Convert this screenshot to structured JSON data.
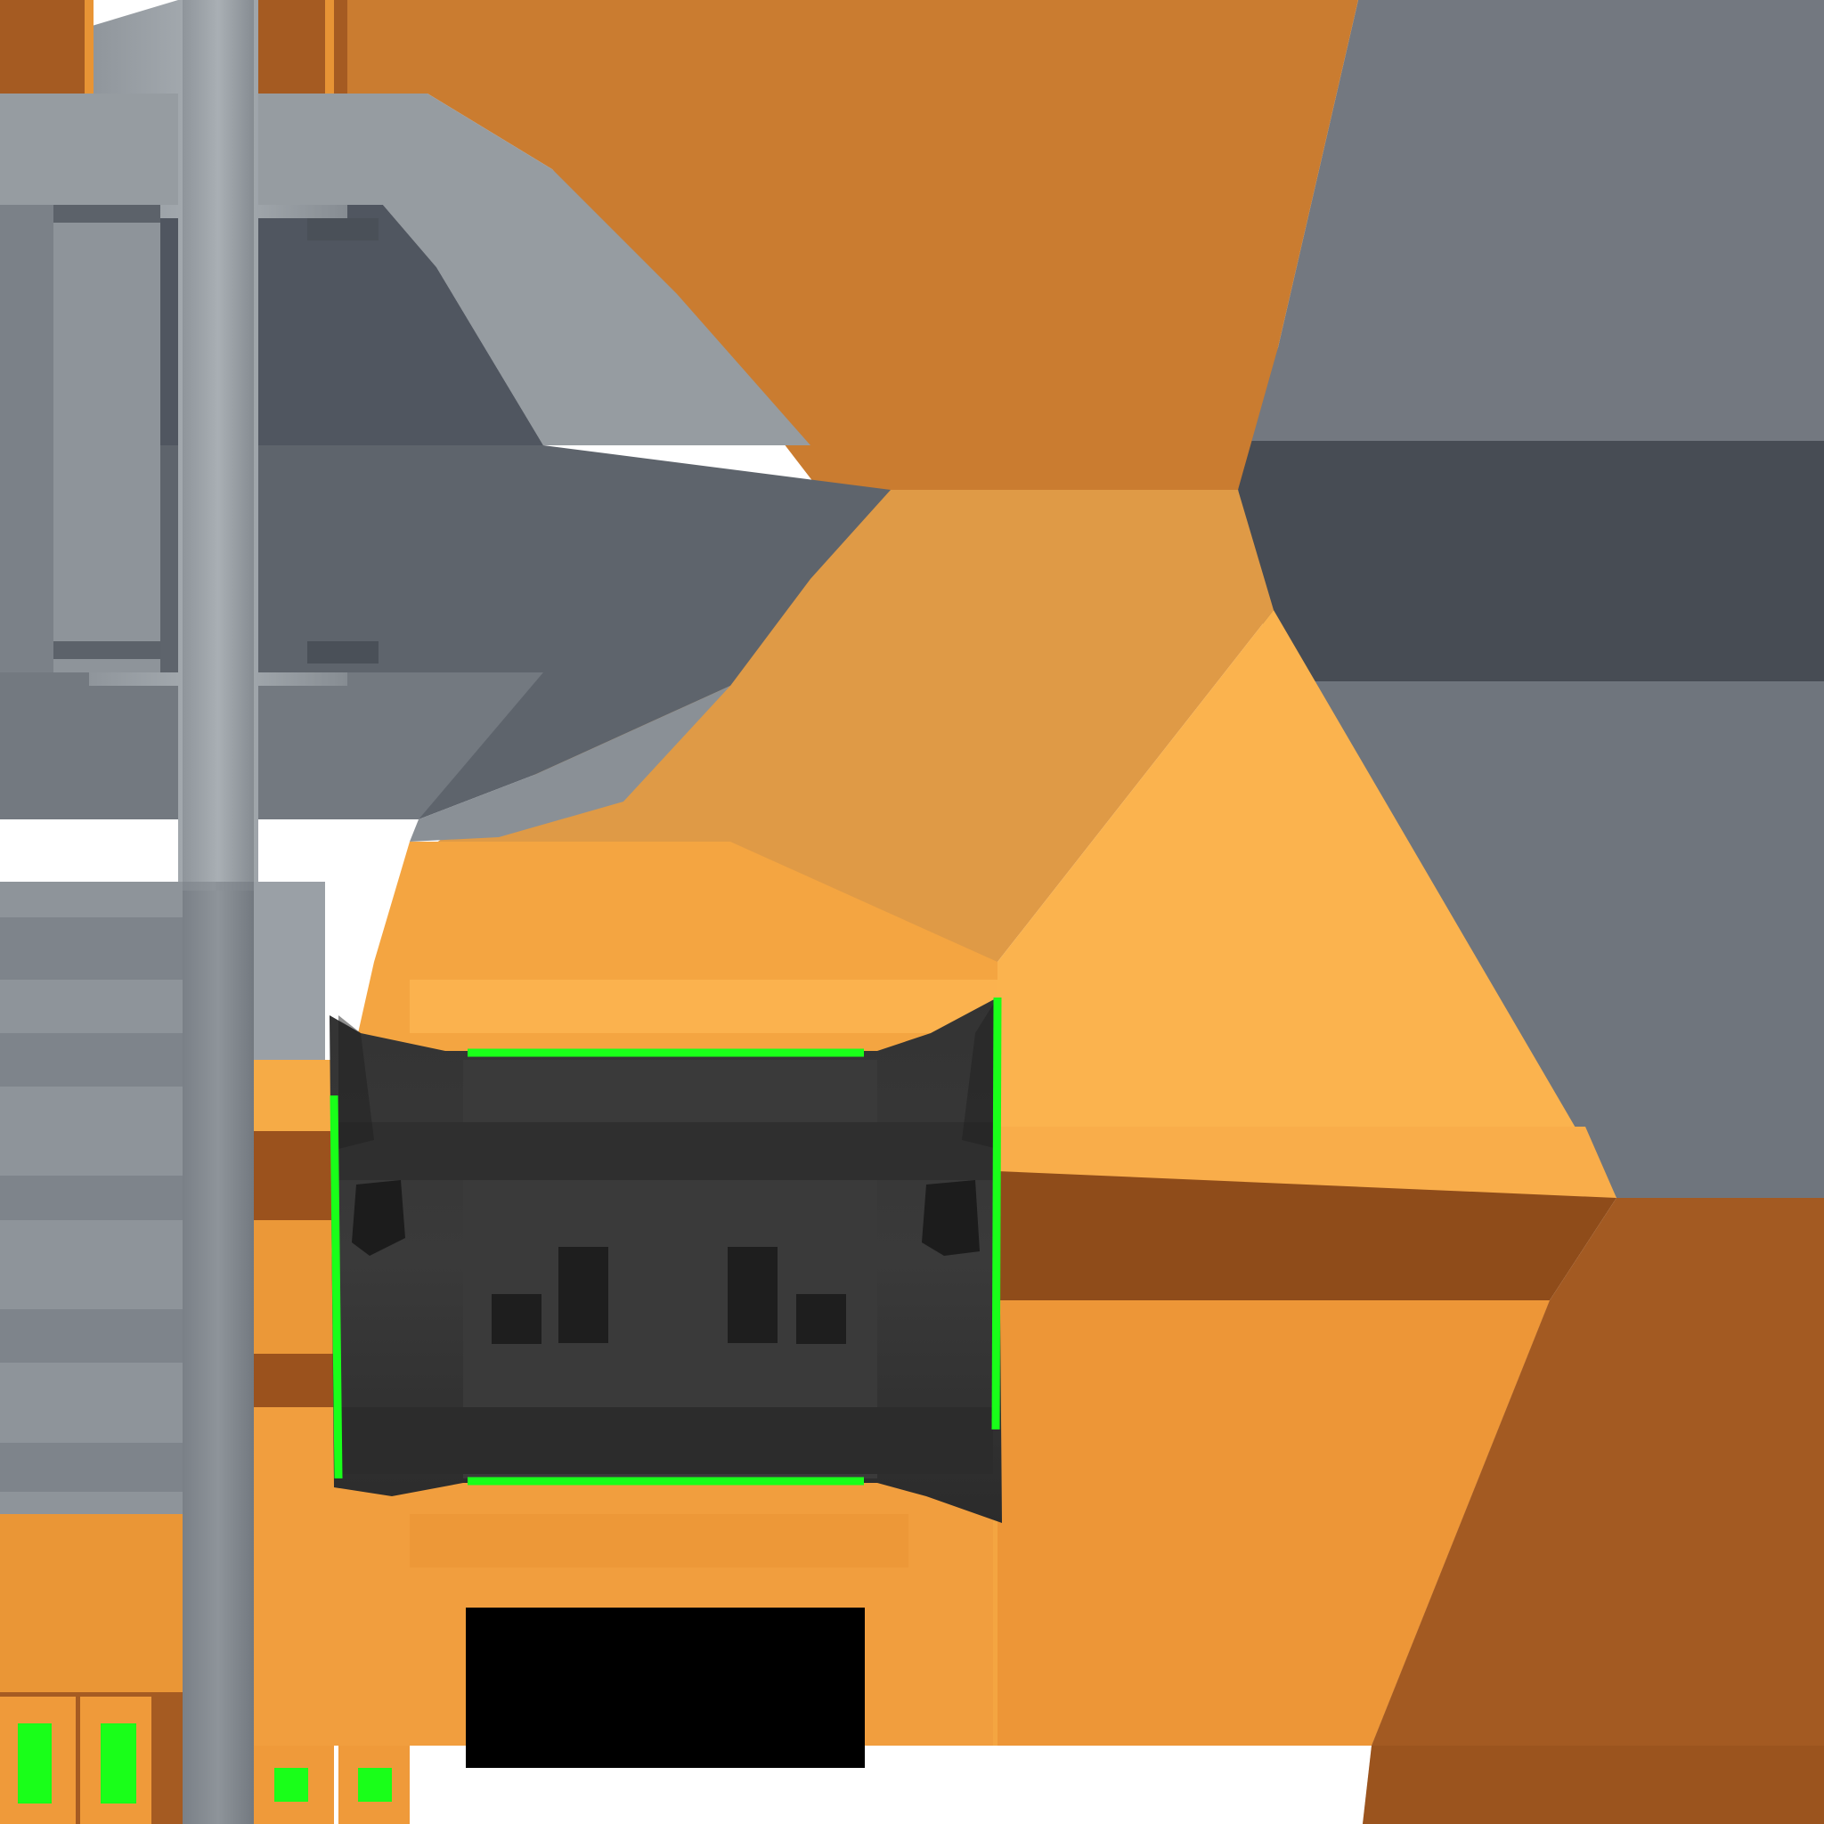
{
  "atlas": {
    "description_visible_text": "",
    "palette": {
      "orange_dark": "#a55a22",
      "orange_mid": "#c97c30",
      "orange_light": "#e89435",
      "orange_pale": "#fbb24e",
      "orange_shadow": "#8f4c1a",
      "grey_light": "#9aa0a6",
      "grey_mid": "#737a82",
      "grey_dark": "#4d535c",
      "grey_darkest": "#454a52",
      "steel_light": "#a9afb4",
      "steel_mid": "#8e949a",
      "panel_black": "#2d2d2d",
      "panel_darker": "#1f1f1f",
      "indicator_green": "#19ff19",
      "screen_black": "#000000"
    },
    "regions": [
      "axe-head-blade-upper",
      "axe-head-blade-lower",
      "handle-pole",
      "control-panel",
      "display-screen",
      "green-indicator-lights"
    ]
  }
}
